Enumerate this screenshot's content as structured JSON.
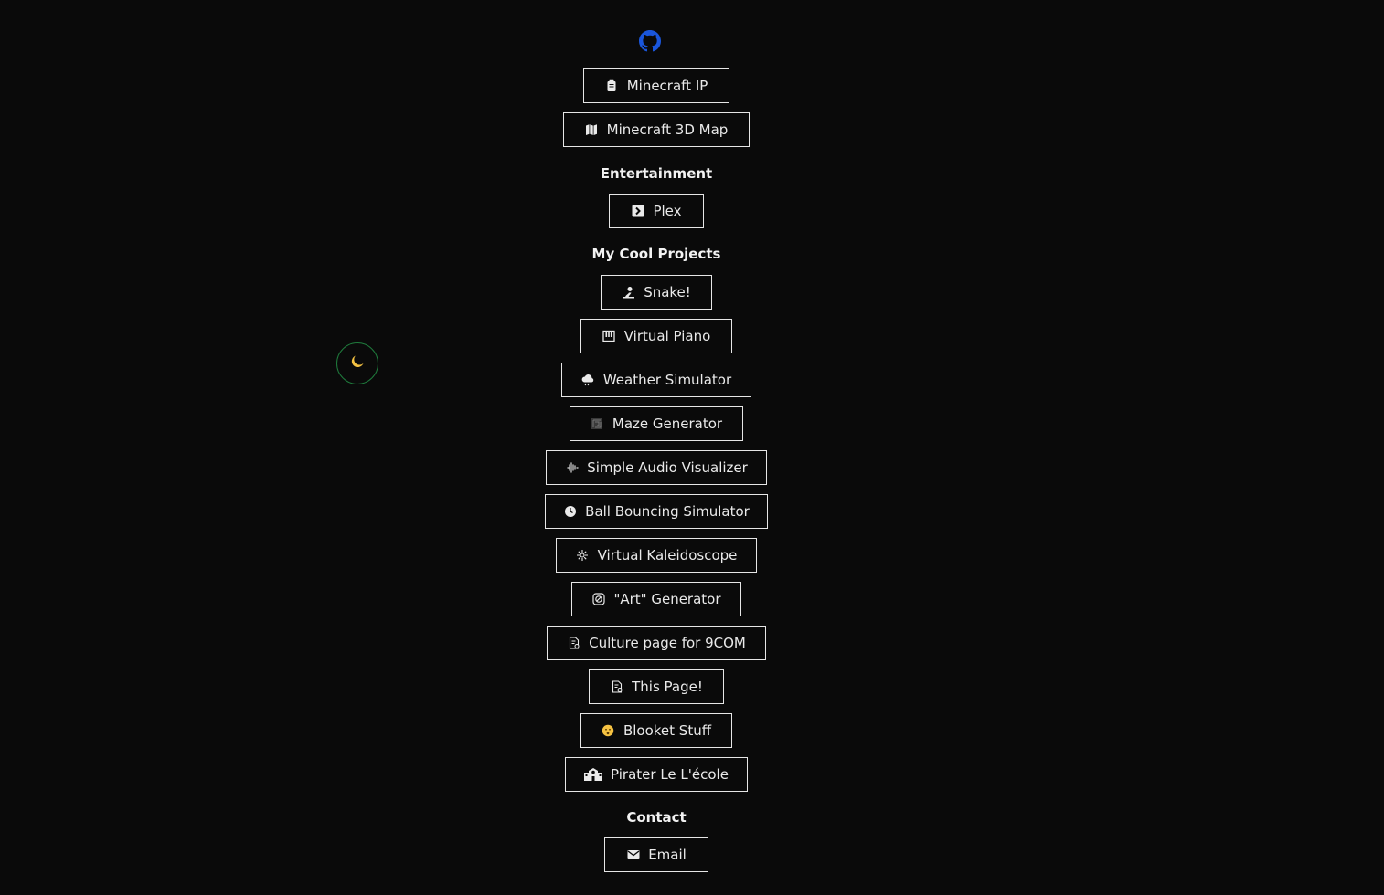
{
  "header": {
    "github_icon": "github-icon"
  },
  "theme_toggle": {
    "icon": "moon-icon"
  },
  "sections": {
    "games": {
      "items": [
        {
          "label": "Minecraft IP",
          "icon": "clipboard-icon"
        },
        {
          "label": "Minecraft 3D Map",
          "icon": "map-icon"
        }
      ]
    },
    "entertainment": {
      "title": "Entertainment",
      "items": [
        {
          "label": "Plex",
          "icon": "plex-icon"
        }
      ]
    },
    "projects": {
      "title": "My Cool Projects",
      "items": [
        {
          "label": "Snake!",
          "icon": "snake-icon"
        },
        {
          "label": "Virtual Piano",
          "icon": "piano-icon"
        },
        {
          "label": "Weather Simulator",
          "icon": "cloud-rain-icon"
        },
        {
          "label": "Maze Generator",
          "icon": "maze-icon"
        },
        {
          "label": "Simple Audio Visualizer",
          "icon": "waveform-icon"
        },
        {
          "label": "Ball Bouncing Simulator",
          "icon": "ball-icon"
        },
        {
          "label": "Virtual Kaleidoscope",
          "icon": "kaleidoscope-icon"
        },
        {
          "label": "\"Art\" Generator",
          "icon": "palette-icon"
        },
        {
          "label": "Culture page for 9COM",
          "icon": "document-icon"
        },
        {
          "label": "This Page!",
          "icon": "document-icon"
        },
        {
          "label": "Blooket Stuff",
          "icon": "face-icon"
        },
        {
          "label": "Pirater Le L'école",
          "icon": "school-icon"
        }
      ]
    },
    "contact": {
      "title": "Contact",
      "items": [
        {
          "label": "Email",
          "icon": "envelope-icon"
        }
      ]
    }
  },
  "colors": {
    "background": "#0a0a0a",
    "button_border": "#e6e6e6",
    "github_blue": "#1a56db",
    "toggle_border": "#1f7a3c",
    "moon": "#f5c242"
  }
}
